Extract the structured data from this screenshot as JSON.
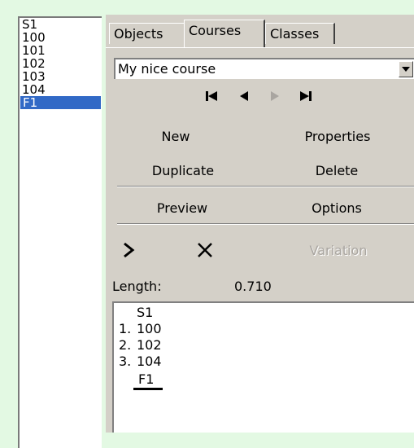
{
  "list": {
    "items": [
      "S1",
      "100",
      "101",
      "102",
      "103",
      "104",
      "F1"
    ],
    "selected_index": 6
  },
  "tabs": [
    {
      "label": "Objects"
    },
    {
      "label": "Courses"
    },
    {
      "label": "Classes"
    }
  ],
  "active_tab": "Courses",
  "course_select": {
    "value": "My nice course"
  },
  "buttons": {
    "new": "New",
    "properties": "Properties",
    "duplicate": "Duplicate",
    "delete": "Delete",
    "preview": "Preview",
    "options": "Options",
    "variation": "Variation"
  },
  "length": {
    "label": "Length:",
    "value": "0.710"
  },
  "course_text": {
    "start": "S1",
    "controls": [
      {
        "num": "1.",
        "code": "100"
      },
      {
        "num": "2.",
        "code": "102"
      },
      {
        "num": "3.",
        "code": "104"
      }
    ],
    "finish": "F1"
  },
  "colors": {
    "selection": "#3169c6",
    "background": "#e3f9e3",
    "panel": "#d4d0c8"
  }
}
